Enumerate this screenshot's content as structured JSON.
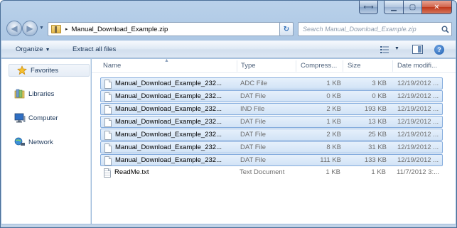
{
  "window": {
    "caption_buttons": {
      "extra_symbol": "⟷",
      "minimize_symbol": "▁",
      "maximize_symbol": "▢",
      "close_symbol": "✕"
    }
  },
  "navigation": {
    "back_symbol": "◀",
    "forward_symbol": "▶",
    "address_path": "Manual_Download_Example.zip",
    "address_separator": "▸",
    "refresh_symbol": "↻",
    "search_placeholder": "Search Manual_Download_Example.zip"
  },
  "toolbar": {
    "organize_label": "Organize",
    "extract_label": "Extract all files",
    "help_symbol": "?"
  },
  "sidebar": {
    "items": [
      {
        "label": "Favorites",
        "icon": "star-icon"
      },
      {
        "label": "Libraries",
        "icon": "libraries-icon"
      },
      {
        "label": "Computer",
        "icon": "computer-icon"
      },
      {
        "label": "Network",
        "icon": "network-icon"
      }
    ]
  },
  "table": {
    "columns": [
      "Name",
      "Type",
      "Compress...",
      "Size",
      "Date modifi..."
    ],
    "rows": [
      {
        "name": "Manual_Download_Example_232...",
        "type": "ADC File",
        "compressed": "1 KB",
        "size": "3 KB",
        "date": "12/19/2012 ...",
        "selected": true
      },
      {
        "name": "Manual_Download_Example_232...",
        "type": "DAT File",
        "compressed": "0 KB",
        "size": "0 KB",
        "date": "12/19/2012 ...",
        "selected": true
      },
      {
        "name": "Manual_Download_Example_232...",
        "type": "IND File",
        "compressed": "2 KB",
        "size": "193 KB",
        "date": "12/19/2012 ...",
        "selected": true
      },
      {
        "name": "Manual_Download_Example_232...",
        "type": "DAT File",
        "compressed": "1 KB",
        "size": "13 KB",
        "date": "12/19/2012 ...",
        "selected": true
      },
      {
        "name": "Manual_Download_Example_232...",
        "type": "DAT File",
        "compressed": "2 KB",
        "size": "25 KB",
        "date": "12/19/2012 ...",
        "selected": true
      },
      {
        "name": "Manual_Download_Example_232...",
        "type": "DAT File",
        "compressed": "8 KB",
        "size": "31 KB",
        "date": "12/19/2012 ...",
        "selected": true
      },
      {
        "name": "Manual_Download_Example_232...",
        "type": "DAT File",
        "compressed": "111 KB",
        "size": "133 KB",
        "date": "12/19/2012 ...",
        "selected": true
      },
      {
        "name": "ReadMe.txt",
        "type": "Text Document",
        "compressed": "1 KB",
        "size": "1 KB",
        "date": "11/7/2012 3:...",
        "selected": false
      }
    ]
  },
  "colors": {
    "selection_fill": "#d9e8f9",
    "selection_border": "#84acdd",
    "chrome": "#b9d1ea"
  }
}
